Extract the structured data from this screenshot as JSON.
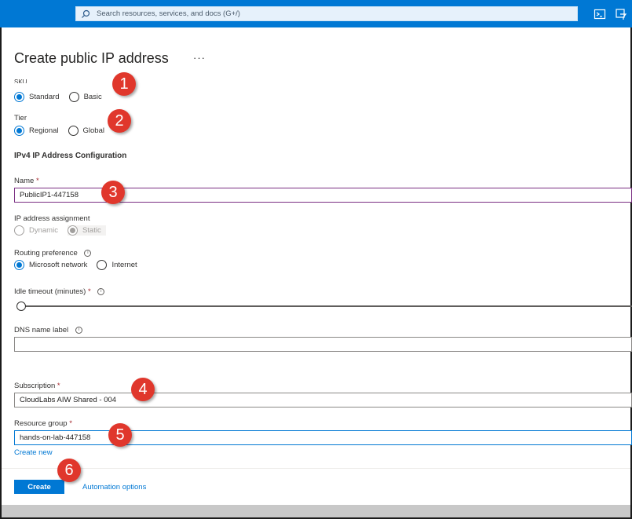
{
  "topbar": {
    "search_placeholder": "Search resources, services, and docs (G+/)",
    "icons": [
      "search-icon",
      "cloud-shell-icon",
      "directory-filter-icon"
    ]
  },
  "page": {
    "title": "Create public IP address",
    "more_label": "···"
  },
  "sku": {
    "label": "SKU",
    "options": [
      "Standard",
      "Basic"
    ],
    "selected": "Standard"
  },
  "tier": {
    "label": "Tier",
    "options": [
      "Regional",
      "Global"
    ],
    "selected": "Regional"
  },
  "section_heading": "IPv4 IP Address Configuration",
  "name_field": {
    "label": "Name",
    "required_mark": "*",
    "value": "PublicIP1-447158"
  },
  "ip_assignment": {
    "label": "IP address assignment",
    "options": [
      "Dynamic",
      "Static"
    ],
    "selected": "Static",
    "disabled": true
  },
  "routing": {
    "label": "Routing preference",
    "options": [
      "Microsoft network",
      "Internet"
    ],
    "selected": "Microsoft network"
  },
  "idle_timeout": {
    "label": "Idle timeout (minutes)",
    "required_mark": "*",
    "slider_value_fraction": 0
  },
  "dns": {
    "label": "DNS name label",
    "value": ""
  },
  "subscription": {
    "label": "Subscription",
    "required_mark": "*",
    "value": "CloudLabs AIW Shared - 004"
  },
  "resource_group": {
    "label": "Resource group",
    "required_mark": "*",
    "value": "hands-on-lab-447158",
    "create_new_label": "Create new"
  },
  "footer": {
    "create_label": "Create",
    "automation_label": "Automation options"
  },
  "annotations": [
    "1",
    "2",
    "3",
    "4",
    "5",
    "6"
  ],
  "colors": {
    "accent": "#0078d4",
    "badge": "#e0372c",
    "required": "#a4262c"
  }
}
